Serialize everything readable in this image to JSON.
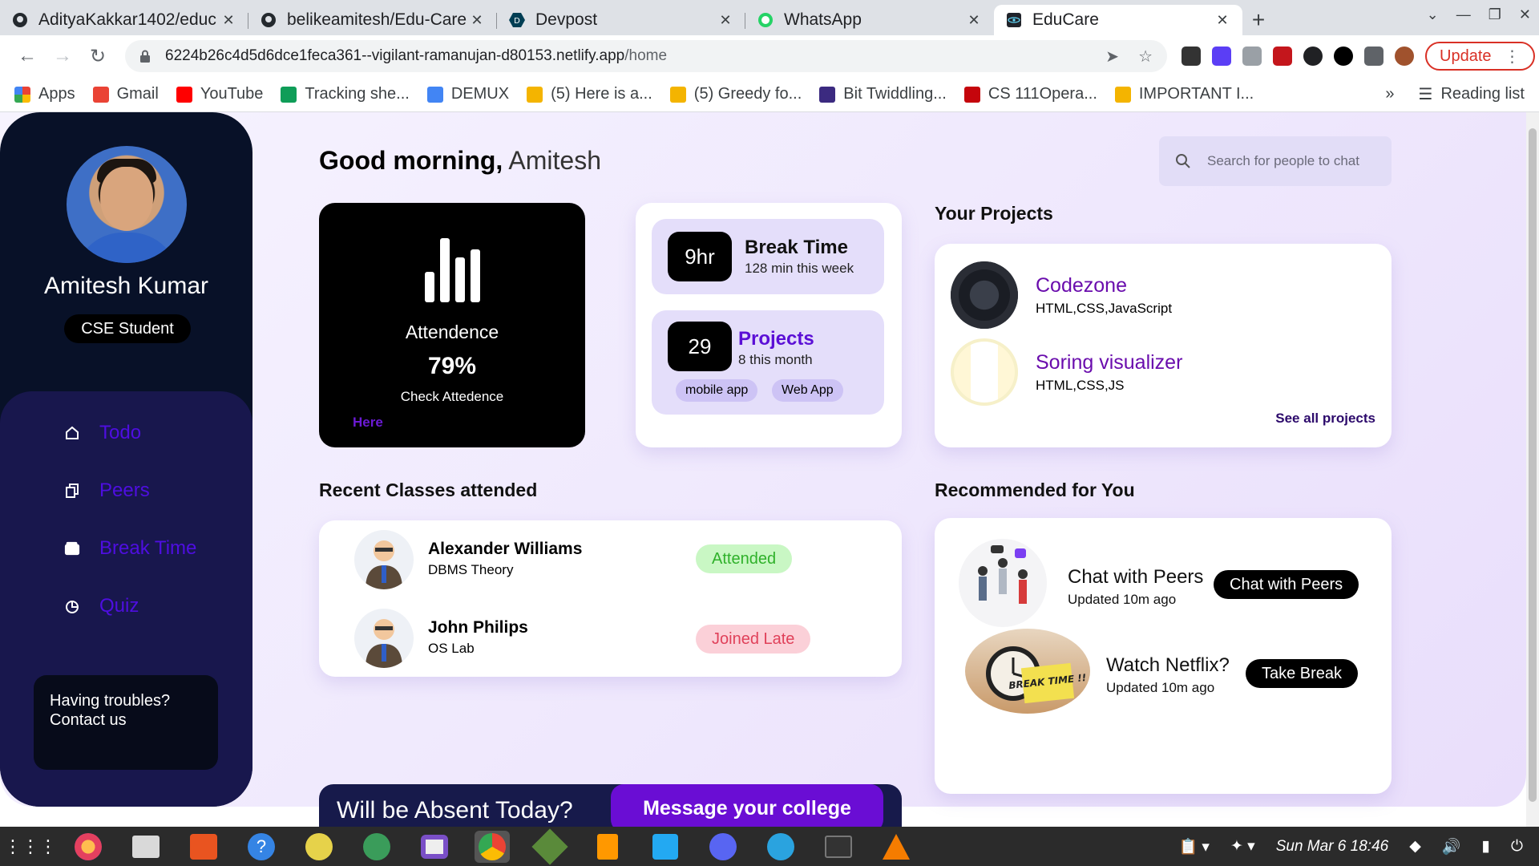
{
  "browser": {
    "tabs": [
      {
        "title": "AdityaKakkar1402/educ",
        "icon": "github-icon"
      },
      {
        "title": "belikeamitesh/Edu-Care",
        "icon": "github-icon"
      },
      {
        "title": "Devpost",
        "icon": "devpost-icon"
      },
      {
        "title": "WhatsApp",
        "icon": "whatsapp-icon"
      },
      {
        "title": "EduCare",
        "icon": "react-icon"
      }
    ],
    "url_host": "6224b26c4d5d6dce1feca361--vigilant-ramanujan-d80153.netlify.app",
    "url_path": "/home",
    "update_label": "Update",
    "bookmarks": [
      {
        "label": "Apps",
        "color": "#ea4335"
      },
      {
        "label": "Gmail",
        "color": "#ea4335"
      },
      {
        "label": "YouTube",
        "color": "#ff0000"
      },
      {
        "label": "Tracking she...",
        "color": "#0f9d58"
      },
      {
        "label": "DEMUX",
        "color": "#4285f4"
      },
      {
        "label": "(5) Here is a...",
        "color": "#f4b400"
      },
      {
        "label": "(5) Greedy fo...",
        "color": "#f4b400"
      },
      {
        "label": "Bit Twiddling...",
        "color": "#3b2a80"
      },
      {
        "label": "CS 111Opera...",
        "color": "#c5050c"
      },
      {
        "label": "IMPORTANT I...",
        "color": "#f4b400"
      }
    ],
    "reading_list": "Reading list"
  },
  "sidebar": {
    "user_name": "Amitesh Kumar",
    "role": "CSE Student",
    "nav": [
      {
        "label": "Todo",
        "icon": "home-icon"
      },
      {
        "label": "Peers",
        "icon": "copy-icon"
      },
      {
        "label": "Break Time",
        "icon": "wallet-icon"
      },
      {
        "label": "Quiz",
        "icon": "pie-chart-icon"
      }
    ],
    "help_line1": "Having troubles?",
    "help_line2": "Contact us"
  },
  "main": {
    "greeting": "Good morning,",
    "greeting_name": "Amitesh",
    "search_placeholder": "Search for people to chat",
    "attendance": {
      "title": "Attendence",
      "percent": "79%",
      "check": "Check Attedence",
      "link": "Here"
    },
    "break_time": {
      "value": "9hr",
      "title": "Break Time",
      "sub": "128 min this week"
    },
    "projects_stat": {
      "value": "29",
      "title": "Projects",
      "sub": "8 this month",
      "chips": [
        "mobile app",
        "Web App"
      ]
    },
    "your_projects": {
      "title": "Your Projects",
      "items": [
        {
          "name": "Codezone",
          "tech": "HTML,CSS,JavaScript"
        },
        {
          "name": "Soring visualizer",
          "tech": "HTML,CSS,JS"
        }
      ],
      "see_all": "See all projects"
    },
    "recent_classes": {
      "title": "Recent Classes attended",
      "items": [
        {
          "teacher": "Alexander Williams",
          "subject": "DBMS Theory",
          "status": "Attended"
        },
        {
          "teacher": "John Philips",
          "subject": "OS Lab",
          "status": "Joined Late"
        }
      ]
    },
    "recommended": {
      "title": "Recommended for You",
      "items": [
        {
          "title": "Chat with Peers",
          "sub": "Updated 10m ago",
          "button": "Chat with Peers"
        },
        {
          "title": "Watch Netflix?",
          "sub": "Updated 10m ago",
          "button": "Take Break",
          "image_text": "BREAK TIME !!"
        }
      ]
    },
    "absent": {
      "text": "Will be Absent Today?",
      "button": "Message your college"
    }
  },
  "taskbar": {
    "clock": "Sun Mar 6  18:46"
  },
  "colors": {
    "sidebar_bg": "#081128",
    "nav_panel_bg": "#18174d",
    "accent_purple": "#6a0dad",
    "nav_link": "#4e0ee0",
    "attended_green": "#2fb12a",
    "late_red": "#e0415a"
  }
}
